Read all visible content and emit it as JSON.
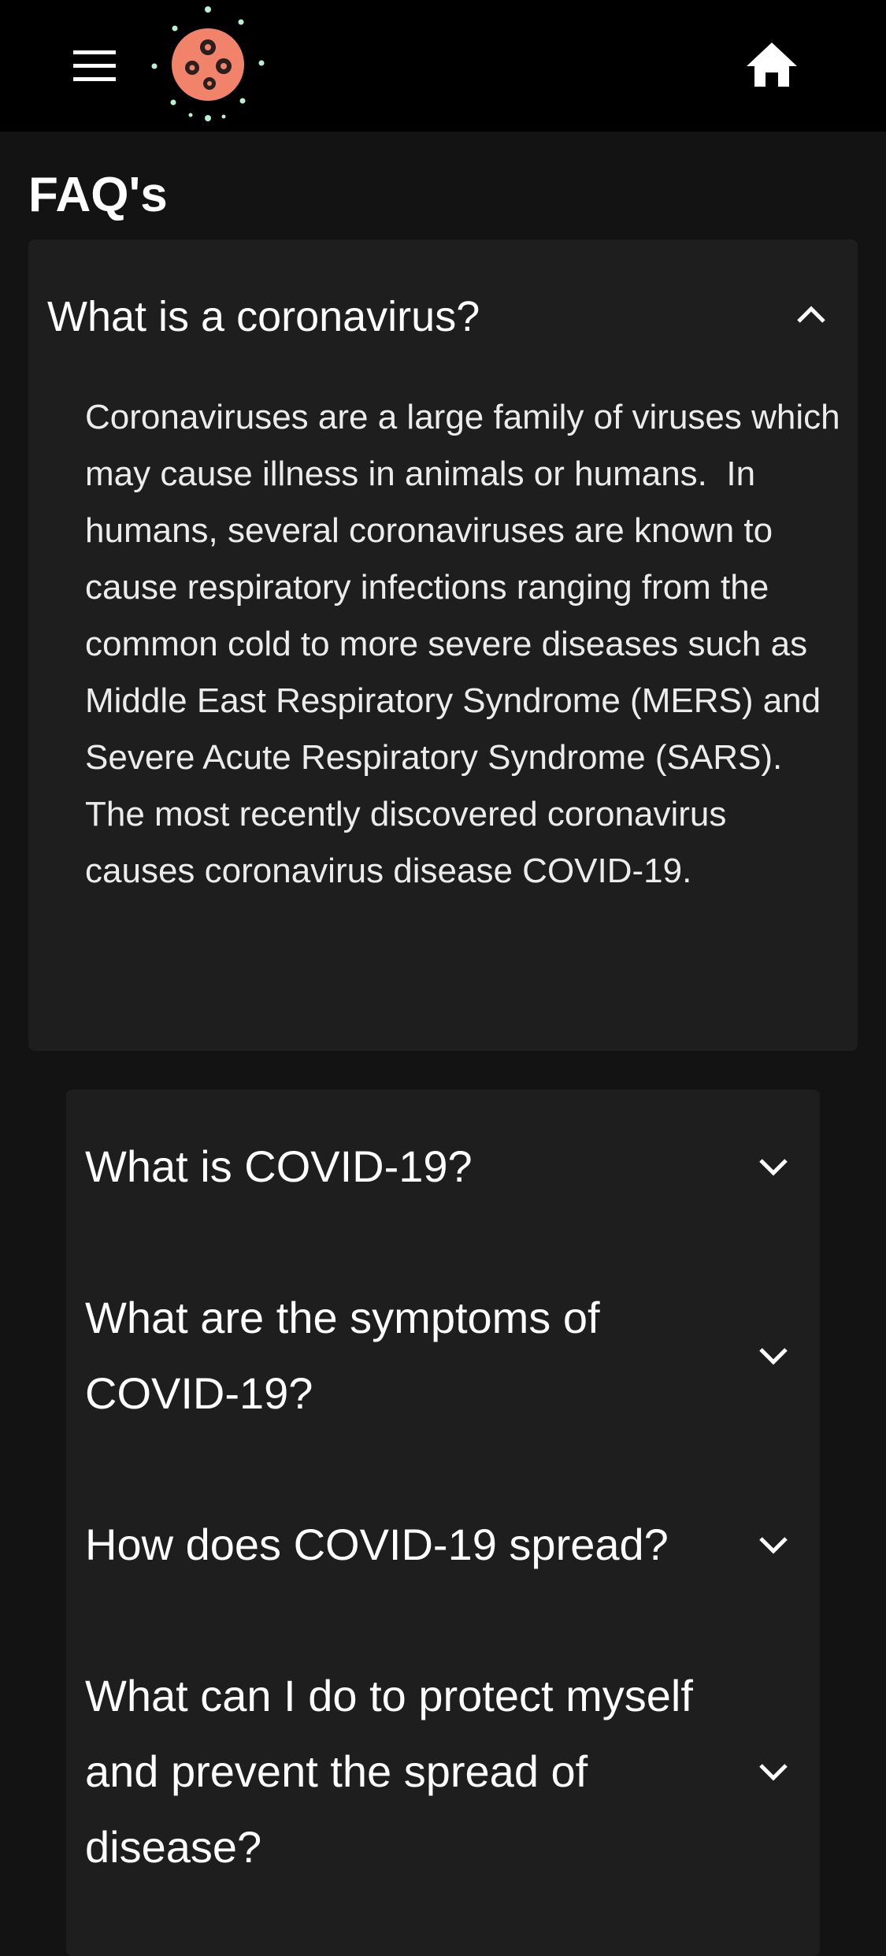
{
  "header": {
    "menu_icon": "hamburger-menu-icon",
    "logo_icon": "virus-logo-icon",
    "home_icon": "home-icon"
  },
  "page": {
    "title": "FAQ's"
  },
  "faq_open": {
    "question": "What is a coronavirus?",
    "answer": "Coronaviruses are a large family of viruses which may cause illness in animals or humans.  In humans, several coronaviruses are known to cause respiratory infections ranging from the common cold to more severe diseases such as Middle East Respiratory Syndrome (MERS) and Severe Acute Respiratory Syndrome (SARS). The most recently discovered coronavirus causes coronavirus disease COVID-19.",
    "expanded": true
  },
  "faq_items": [
    {
      "question": "What is COVID-19?",
      "expanded": false
    },
    {
      "question": "What are the symptoms of COVID-19?",
      "expanded": false
    },
    {
      "question": "How does COVID-19 spread?",
      "expanded": false
    },
    {
      "question": "What can I do to protect myself and prevent the spread of disease?",
      "expanded": false
    }
  ],
  "colors": {
    "background": "#131313",
    "topbar": "#000000",
    "card": "#1e1e1e",
    "logo_body": "#f2836b",
    "logo_dots": "#b9efd3"
  }
}
